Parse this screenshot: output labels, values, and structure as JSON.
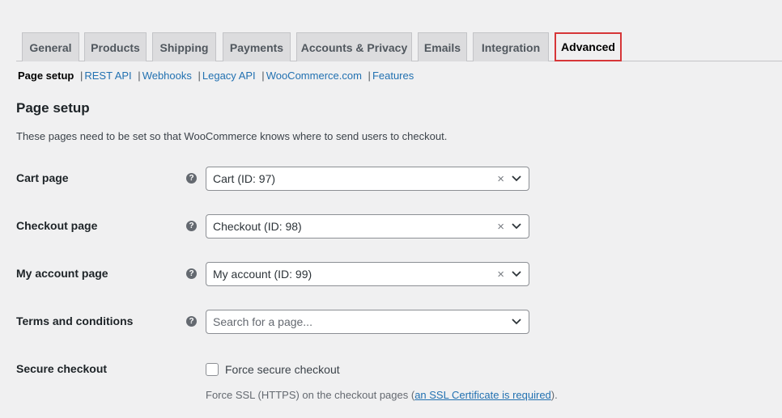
{
  "tabs": [
    {
      "label": "General"
    },
    {
      "label": "Products"
    },
    {
      "label": "Shipping"
    },
    {
      "label": "Payments"
    },
    {
      "label": "Accounts & Privacy"
    },
    {
      "label": "Emails"
    },
    {
      "label": "Integration"
    },
    {
      "label": "Advanced",
      "active": true
    }
  ],
  "subnav": {
    "current": "Page setup",
    "separator": "|",
    "links": [
      "REST API",
      "Webhooks",
      "Legacy API",
      "WooCommerce.com",
      "Features"
    ]
  },
  "section": {
    "title": "Page setup",
    "description": "These pages need to be set so that WooCommerce knows where to send users to checkout."
  },
  "fields": {
    "cart": {
      "label": "Cart page",
      "value": "Cart (ID: 97)",
      "help": "?",
      "clear": "×"
    },
    "checkout": {
      "label": "Checkout page",
      "value": "Checkout (ID: 98)",
      "help": "?",
      "clear": "×"
    },
    "account": {
      "label": "My account page",
      "value": "My account (ID: 99)",
      "help": "?",
      "clear": "×"
    },
    "terms": {
      "label": "Terms and conditions",
      "placeholder": "Search for a page...",
      "help": "?"
    }
  },
  "secure": {
    "label": "Secure checkout",
    "checkbox_label": "Force secure checkout",
    "checked": false,
    "desc_before": "Force SSL (HTTPS) on the checkout pages (",
    "desc_link": "an SSL Certificate is required",
    "desc_after": ")."
  },
  "colors": {
    "background": "#f0f0f1",
    "active_tab_border": "#d63638",
    "link": "#2271b1"
  }
}
